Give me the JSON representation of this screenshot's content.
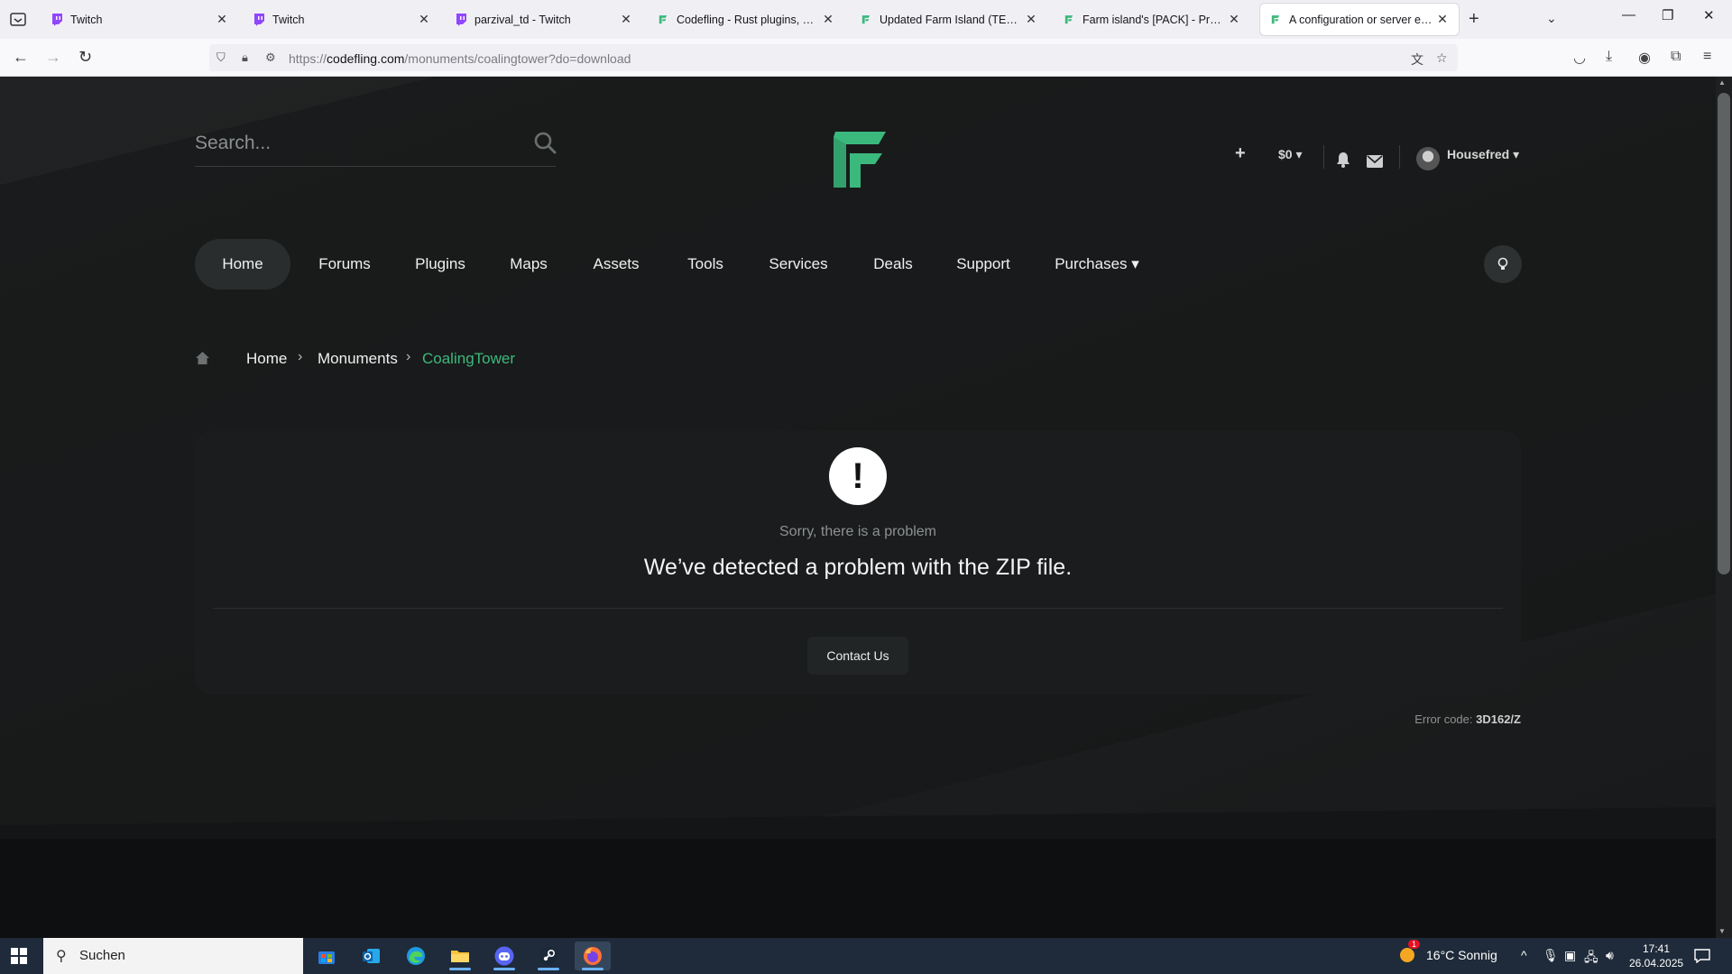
{
  "browser": {
    "tabs": [
      {
        "title": "Twitch",
        "favicon": "twitch"
      },
      {
        "title": "Twitch",
        "favicon": "twitch"
      },
      {
        "title": "parzival_td - Twitch",
        "favicon": "twitch"
      },
      {
        "title": "Codefling - Rust plugins, maps",
        "favicon": "codefling"
      },
      {
        "title": "Updated Farm Island (TEMP) - S",
        "favicon": "codefling"
      },
      {
        "title": "Farm island's [PACK] - Prefabs -",
        "favicon": "codefling"
      },
      {
        "title": "A configuration or server error",
        "favicon": "codefling",
        "active": true
      }
    ],
    "url": {
      "prefix": "https://",
      "host": "codefling.com",
      "path": "/monuments/coalingtower?do=download"
    }
  },
  "site": {
    "search_placeholder": "Search...",
    "header": {
      "plus_label": "+",
      "balance": "$0 ▾",
      "username": "Housefred ▾"
    },
    "nav": [
      {
        "label": "Home",
        "active": true
      },
      {
        "label": "Forums"
      },
      {
        "label": "Plugins"
      },
      {
        "label": "Maps"
      },
      {
        "label": "Assets"
      },
      {
        "label": "Tools"
      },
      {
        "label": "Services"
      },
      {
        "label": "Deals"
      },
      {
        "label": "Support"
      },
      {
        "label": "Purchases ▾"
      }
    ],
    "breadcrumb": {
      "home": "Home",
      "section": "Monuments",
      "current": "CoalingTower"
    },
    "error": {
      "icon_glyph": "!",
      "subtitle": "Sorry, there is a problem",
      "title": "We’ve detected a problem with the ZIP file.",
      "button": "Contact Us",
      "code_label": "Error code:",
      "code_value": "3D162/Z"
    },
    "colors": {
      "accent": "#3bb97d",
      "breadcrumb_current": "#3bb97d",
      "page_bg": "#1c1e1f",
      "card_bg": "#1a1c1d"
    }
  },
  "taskbar": {
    "search_text": "Suchen",
    "weather": "16°C  Sonnig",
    "weather_badge": "1",
    "time": "17:41",
    "date": "26.04.2025"
  }
}
